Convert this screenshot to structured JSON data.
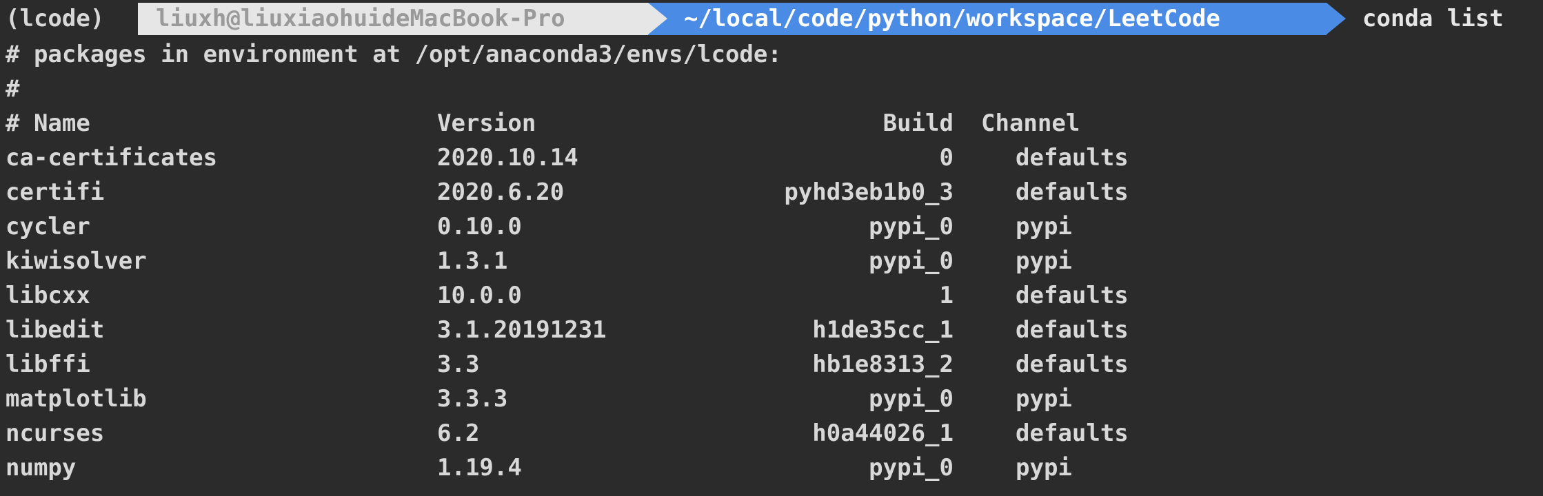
{
  "prompt": {
    "env": "(lcode)",
    "host": "liuxh@liuxiaohuideMacBook-Pro",
    "path": "~/local/code/python/workspace/LeetCode",
    "command": "conda list"
  },
  "header": {
    "env_line": "# packages in environment at /opt/anaconda3/envs/lcode:",
    "hash_line": "#",
    "columns": {
      "name": "# Name",
      "version": "Version",
      "build": "Build",
      "channel": "Channel"
    }
  },
  "packages": [
    {
      "name": "ca-certificates",
      "version": "2020.10.14",
      "build": "0",
      "channel": "defaults"
    },
    {
      "name": "certifi",
      "version": "2020.6.20",
      "build": "pyhd3eb1b0_3",
      "channel": "defaults"
    },
    {
      "name": "cycler",
      "version": "0.10.0",
      "build": "pypi_0",
      "channel": "pypi"
    },
    {
      "name": "kiwisolver",
      "version": "1.3.1",
      "build": "pypi_0",
      "channel": "pypi"
    },
    {
      "name": "libcxx",
      "version": "10.0.0",
      "build": "1",
      "channel": "defaults"
    },
    {
      "name": "libedit",
      "version": "3.1.20191231",
      "build": "h1de35cc_1",
      "channel": "defaults"
    },
    {
      "name": "libffi",
      "version": "3.3",
      "build": "hb1e8313_2",
      "channel": "defaults"
    },
    {
      "name": "matplotlib",
      "version": "3.3.3",
      "build": "pypi_0",
      "channel": "pypi"
    },
    {
      "name": "ncurses",
      "version": "6.2",
      "build": "h0a44026_1",
      "channel": "defaults"
    },
    {
      "name": "numpy",
      "version": "1.19.4",
      "build": "pypi_0",
      "channel": "pypi"
    }
  ]
}
